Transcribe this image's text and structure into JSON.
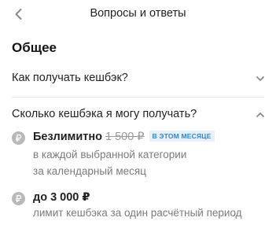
{
  "header": {
    "title": "Вопросы и ответы",
    "back_icon": "chevron-left-icon"
  },
  "section": {
    "title": "Общее"
  },
  "faq": [
    {
      "question": "Как получать кешбэк?",
      "expanded": false,
      "icon": "chevron-down-icon"
    },
    {
      "question": "Сколько кешбэка я могу получать?",
      "expanded": true,
      "icon": "chevron-up-icon"
    }
  ],
  "answer_items": [
    {
      "icon": "ruble-coin-icon",
      "main": "Безлимитно",
      "old_value": "1 500 ₽",
      "badge": "В ЭТОМ МЕСЯЦЕ",
      "lines": [
        "в каждой выбранной категории",
        "за календарный месяц"
      ]
    },
    {
      "icon": "ruble-coin-icon",
      "main": "до 3 000 ₽",
      "lines": [
        "лимит кешбэка за один расчётный период"
      ]
    }
  ],
  "colors": {
    "badge_bg": "#e7f1fb",
    "badge_text": "#2f86d4",
    "coin": "#b9b9b9",
    "secondary_text": "#7b7b7b"
  }
}
